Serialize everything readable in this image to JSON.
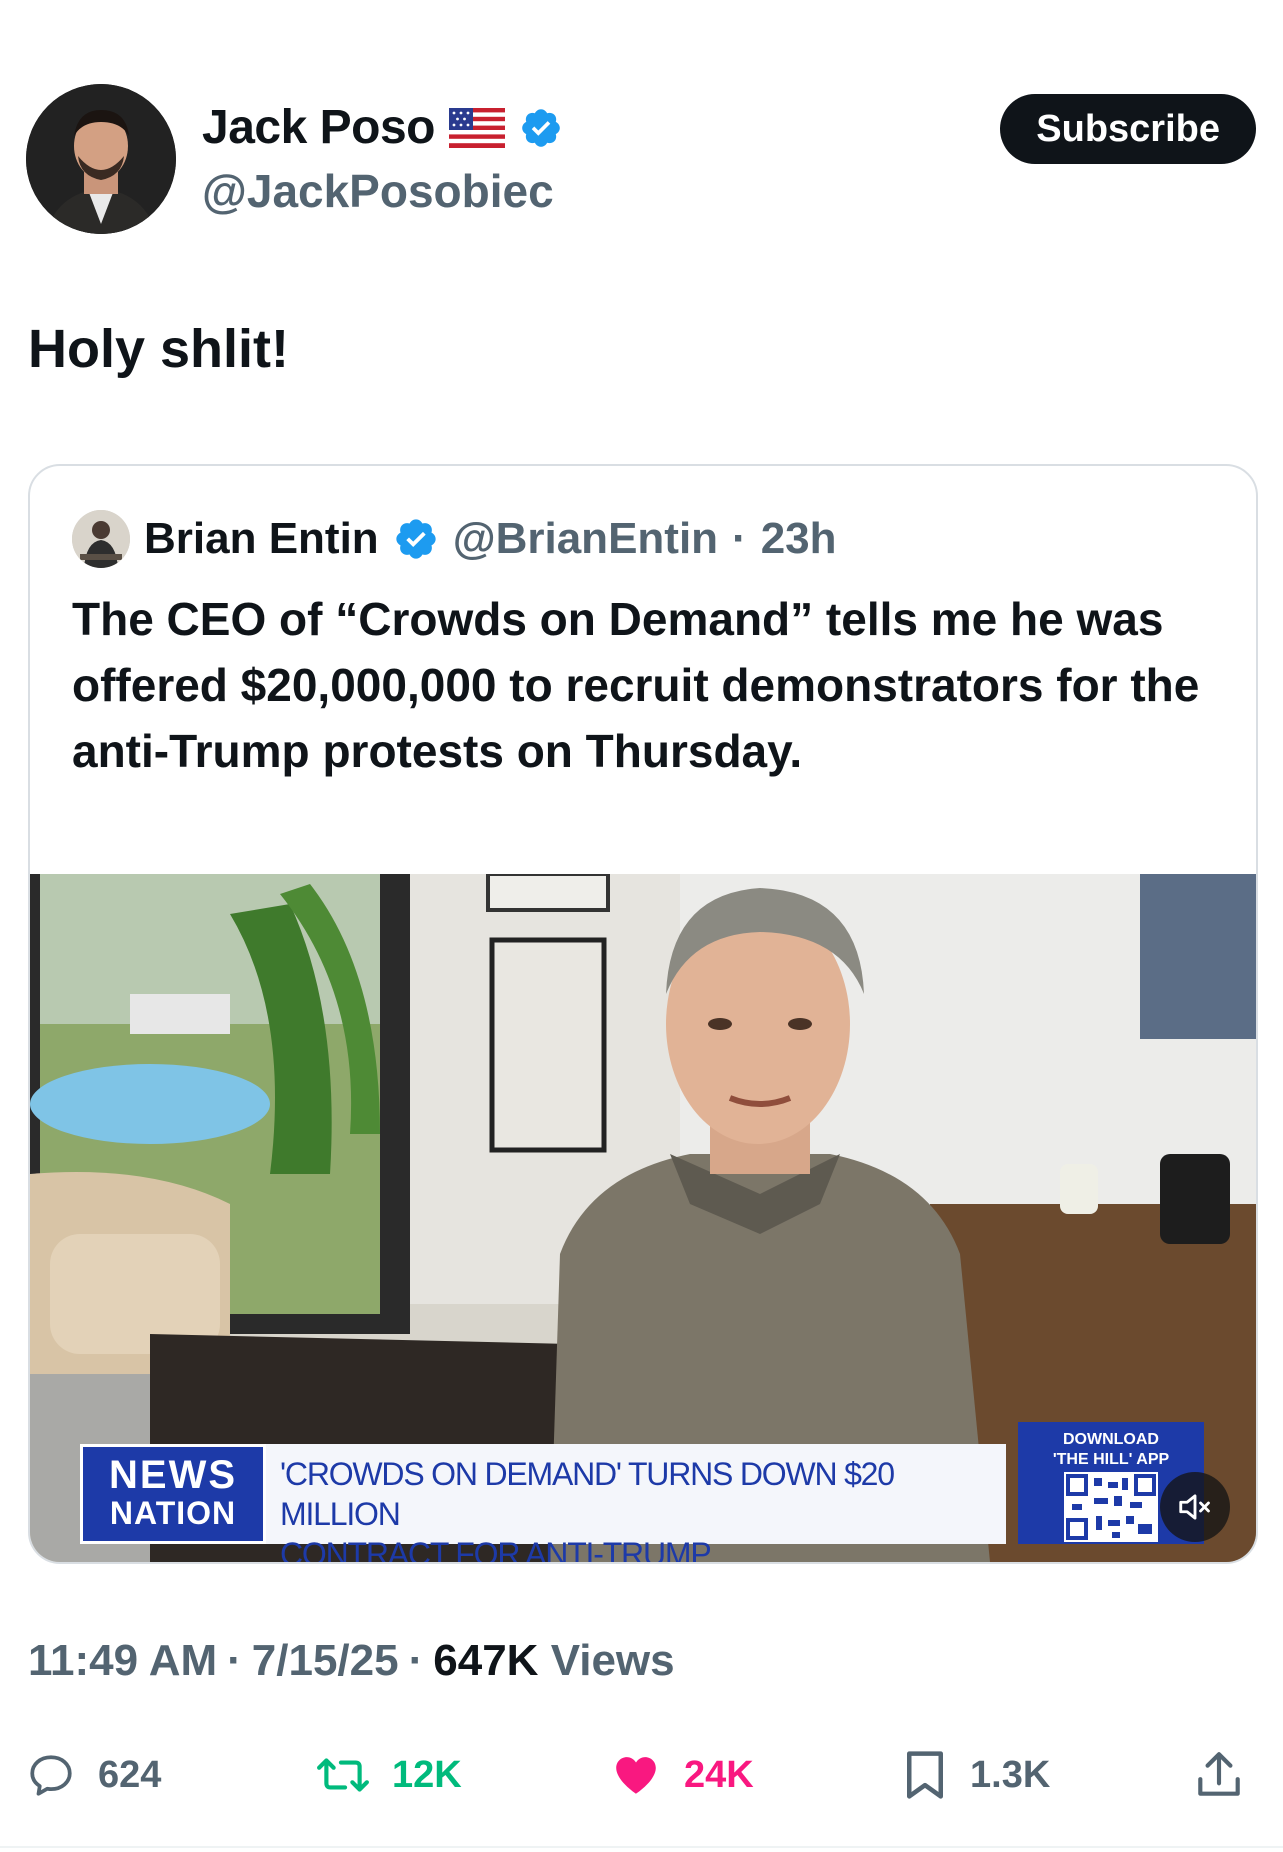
{
  "author": {
    "display_name": "Jack Poso",
    "handle": "@JackPosobiec",
    "flag_icon": "us-flag-icon",
    "verified_icon": "verified-badge-icon",
    "avatar": "avatar"
  },
  "subscribe_label": "Subscribe",
  "post_text": "Holy shlit!",
  "quoted": {
    "display_name": "Brian Entin",
    "handle": "@BrianEntin",
    "separator": "·",
    "time": "23h",
    "text": "The CEO of “Crowds on Demand” tells me he was offered $20,000,000 to recruit demonstrators for the anti-Trump protests on Thursday.",
    "video": {
      "logo_line1": "NEWS",
      "logo_line2": "NATION",
      "chyron_line1": "'CROWDS ON DEMAND' TURNS DOWN $20 MILLION",
      "chyron_line2": "CONTRACT FOR ANTI-TRUMP DEMONSTRATIONS",
      "app_line1": "DOWNLOAD",
      "app_line2": "'THE HILL' APP",
      "mute_icon": "muted-speaker-icon"
    }
  },
  "meta": {
    "time": "11:49 AM",
    "date": "7/15/25",
    "views_count": "647K",
    "views_label": "Views",
    "separator": "·"
  },
  "actions": {
    "replies": "624",
    "reposts": "12K",
    "likes": "24K",
    "bookmarks": "1.3K"
  },
  "colors": {
    "text": "#0f1419",
    "secondary": "#536471",
    "verified": "#1d9bf0",
    "repost": "#00ba7c",
    "like": "#f91880",
    "newsnation_blue": "#1d3aa8"
  }
}
